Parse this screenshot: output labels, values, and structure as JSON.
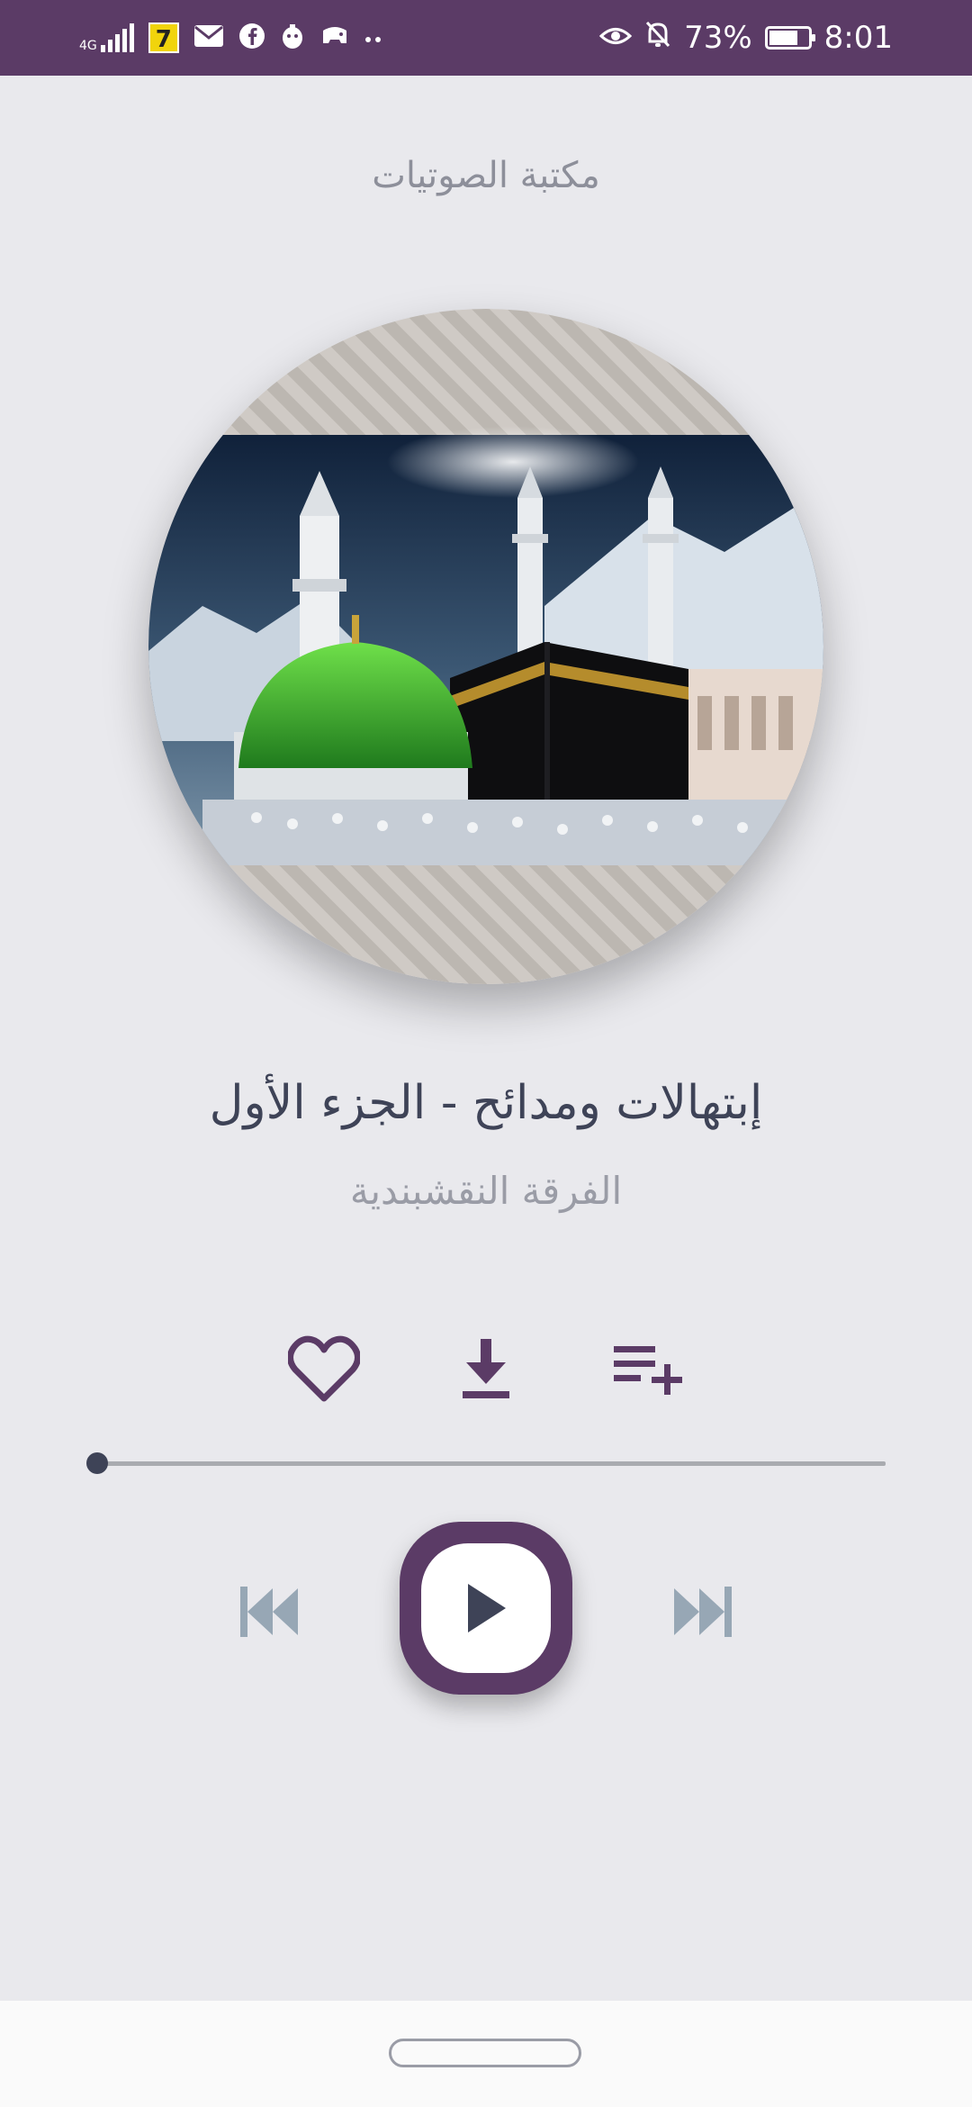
{
  "status_bar": {
    "network_type": "4G",
    "battery_percent": "73%",
    "battery_level": 0.73,
    "time": "8:01",
    "icons": [
      "signal-icon",
      "app-badge-icon",
      "mail-icon",
      "facebook-icon",
      "app-icon",
      "game-icon",
      "more-icon",
      "eye-icon",
      "notifications-off-icon",
      "battery-icon"
    ],
    "app_badge_label": "7"
  },
  "header": {
    "title": "مكتبة الصوتيات"
  },
  "track": {
    "title": "إبتهالات ومدائح - الجزء الأول",
    "artist": "الفرقة النقشبندية"
  },
  "actions": {
    "icons": [
      "heart-icon",
      "download-icon",
      "playlist-add-icon"
    ]
  },
  "progress": {
    "fraction": 0.0
  },
  "controls": {
    "icons": [
      "skip-previous-icon",
      "play-icon",
      "skip-next-icon"
    ]
  },
  "colors": {
    "accent": "#5b3b66",
    "background": "#e9e9ed",
    "text_primary": "#3e4357",
    "text_secondary": "#9a9ca6"
  }
}
